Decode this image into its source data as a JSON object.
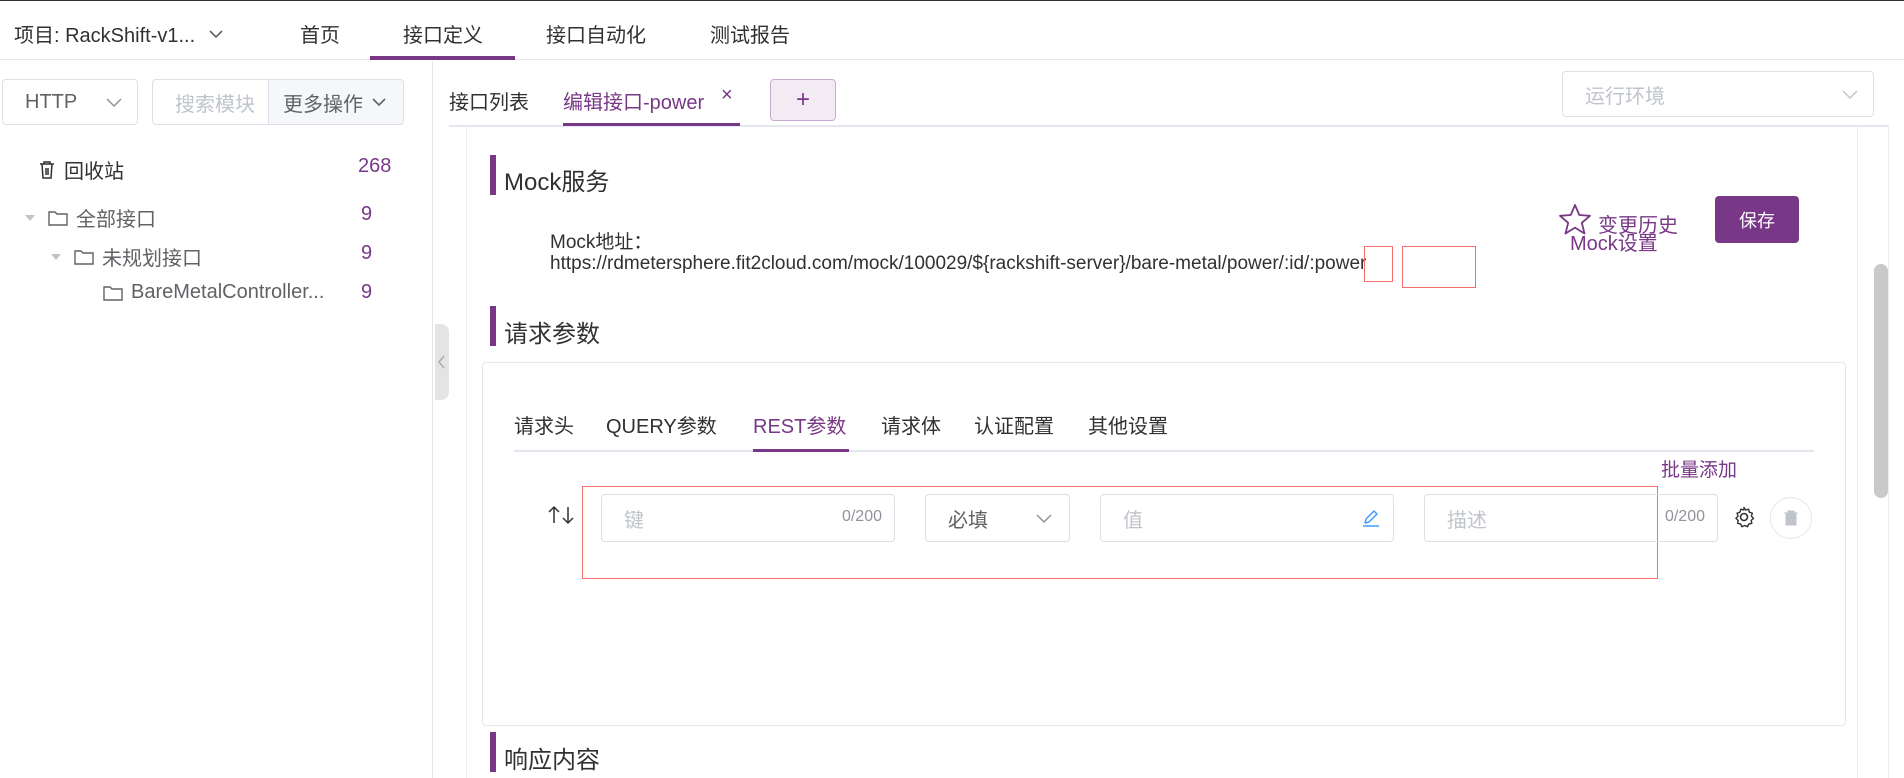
{
  "topbar": {
    "project_label": "项目: RackShift-v1...",
    "nav": [
      "首页",
      "接口定义",
      "接口自动化",
      "测试报告"
    ],
    "active_nav_index": 1
  },
  "sidebar": {
    "protocol": "HTTP",
    "search_placeholder": "搜索模块",
    "more_actions": "更多操作",
    "trash": {
      "label": "回收站",
      "count": "268"
    },
    "tree": [
      {
        "label": "全部接口",
        "count": "9",
        "level": 0
      },
      {
        "label": "未规划接口",
        "count": "9",
        "level": 1
      },
      {
        "label": "BareMetalController...",
        "count": "9",
        "level": 2
      }
    ]
  },
  "tabs": {
    "list_label": "接口列表",
    "edit_label": "编辑接口-power",
    "close_glyph": "×",
    "add_glyph": "+",
    "env_placeholder": "运行环境"
  },
  "mock": {
    "section_title": "Mock服务",
    "address_label": "Mock地址：",
    "url_prefix": "https://rdmetersphere.fit2cloud.com/mock/100029/${rackshift-server}/bare-metal/power/",
    "url_id": ":id",
    "url_sep": "/",
    "url_power": ":power",
    "history_label": "变更历史",
    "mock_settings_label": "Mock设置",
    "save_label": "保存"
  },
  "request": {
    "section_title": "请求参数",
    "tabs": [
      "请求头",
      "QUERY参数",
      "REST参数",
      "请求体",
      "认证配置",
      "其他设置"
    ],
    "active_tab_index": 2,
    "batch_add_label": "批量添加",
    "row": {
      "key_placeholder": "键",
      "key_counter": "0/200",
      "required_value": "必填",
      "value_placeholder": "值",
      "desc_placeholder": "描述",
      "desc_counter": "0/200"
    }
  },
  "response": {
    "section_title": "响应内容"
  },
  "colors": {
    "accent": "#783887",
    "border": "#dcdfe6",
    "highlight_box": "#f56c6c"
  }
}
